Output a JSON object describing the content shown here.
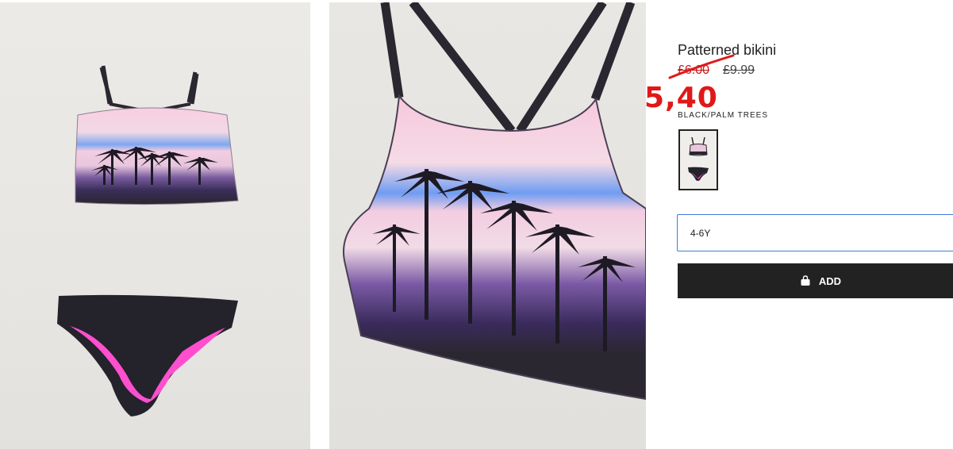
{
  "product": {
    "title": "Patterned bikini",
    "old_sale_price": "£6.00",
    "original_price": "£9.99",
    "new_price": "5,40",
    "color_name": "BLACK/PALM TREES"
  },
  "size_field": {
    "value": "4-6Y"
  },
  "add_button": {
    "label": "ADD",
    "icon": "shopping-bag-icon"
  },
  "colors": {
    "sale_red": "#e01818",
    "button_bg": "#222222",
    "field_border": "#3f7dd8",
    "swim_pink": "#f6c8dc",
    "swim_black": "#24222b",
    "lining_pink": "#ff4fcf"
  }
}
